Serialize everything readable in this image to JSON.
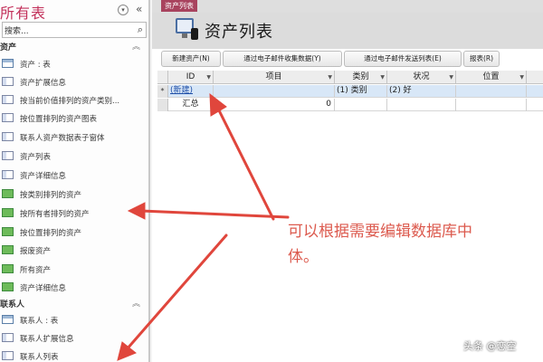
{
  "nav": {
    "title": "所有表",
    "search_placeholder": "搜索...",
    "groups": [
      {
        "label": "资产",
        "items": [
          {
            "label": "资产 : 表",
            "icon": "table-icon"
          },
          {
            "label": "资产扩展信息",
            "icon": "form-icon"
          },
          {
            "label": "按当前价值排列的资产类别...",
            "icon": "form-icon"
          },
          {
            "label": "按位置排列的资产图表",
            "icon": "form-icon"
          },
          {
            "label": "联系人资产数据表子窗体",
            "icon": "form-icon"
          },
          {
            "label": "资产列表",
            "icon": "form-icon"
          },
          {
            "label": "资产详细信息",
            "icon": "form-icon"
          },
          {
            "label": "按类别排列的资产",
            "icon": "report-icon"
          },
          {
            "label": "按所有者排列的资产",
            "icon": "report-icon"
          },
          {
            "label": "按位置排列的资产",
            "icon": "report-icon"
          },
          {
            "label": "报废资产",
            "icon": "report-icon"
          },
          {
            "label": "所有资产",
            "icon": "report-icon"
          },
          {
            "label": "资产详细信息",
            "icon": "report-icon"
          }
        ]
      },
      {
        "label": "联系人",
        "items": [
          {
            "label": "联系人 : 表",
            "icon": "table-icon"
          },
          {
            "label": "联系人扩展信息",
            "icon": "form-icon"
          },
          {
            "label": "联系人列表",
            "icon": "form-icon"
          }
        ]
      }
    ]
  },
  "doc": {
    "tab_label": "资产列表",
    "form_title": "资产列表",
    "buttons": [
      "新建资产(N)",
      "通过电子邮件收集数据(Y)",
      "通过电子邮件发送列表(E)",
      "报表(R)"
    ],
    "columns": [
      "ID",
      "项目",
      "类别",
      "状况",
      "位置"
    ],
    "new_row": {
      "selector": "*",
      "id": "(新建)",
      "category": "(1) 类别",
      "condition": "(2) 好"
    },
    "total_row": {
      "label": "汇总",
      "value": "0"
    }
  },
  "annotation": {
    "text": "可以根据需要编辑数据库中",
    "text_line2": "体。",
    "color": "#dc5a4e"
  },
  "watermark": "头条 @恋空"
}
